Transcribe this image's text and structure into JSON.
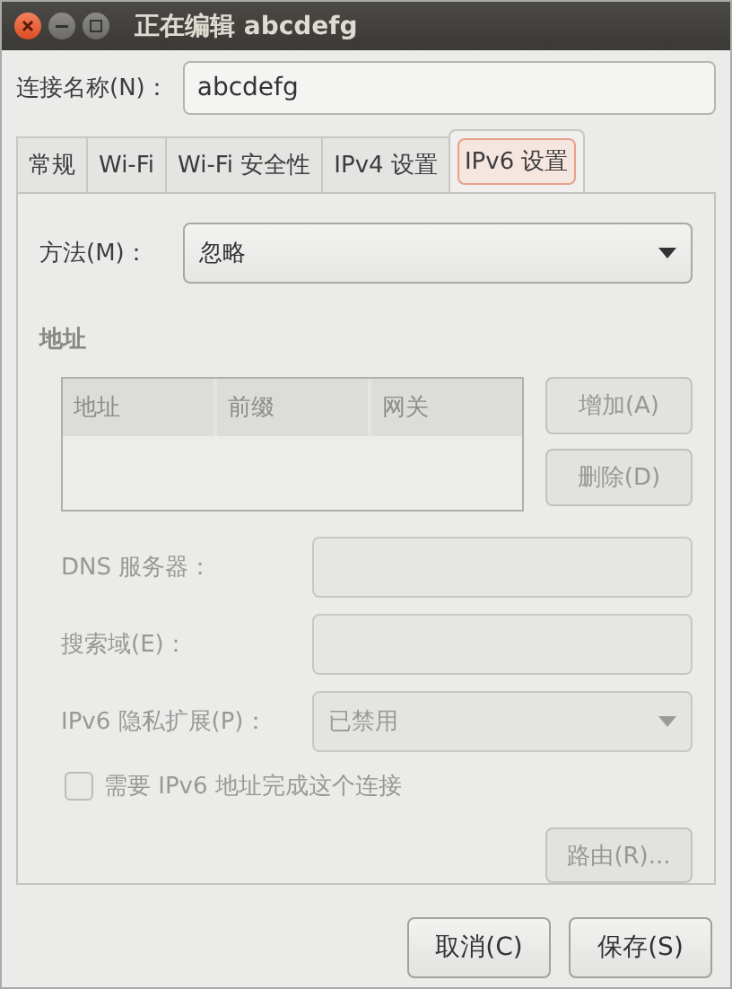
{
  "window": {
    "title": "正在编辑 abcdefg"
  },
  "connection_name": {
    "label": "连接名称(N)：",
    "value": "abcdefg"
  },
  "tabs": [
    {
      "label": "常规",
      "selected": false
    },
    {
      "label": "Wi-Fi",
      "selected": false
    },
    {
      "label": "Wi-Fi 安全性",
      "selected": false
    },
    {
      "label": "IPv4 设置",
      "selected": false
    },
    {
      "label": "IPv6 设置",
      "selected": true
    }
  ],
  "method": {
    "label": "方法(M)：",
    "value": "忽略"
  },
  "addresses": {
    "heading": "地址",
    "columns": [
      "地址",
      "前缀",
      "网关"
    ],
    "disabled": true,
    "buttons": [
      {
        "label": "增加(A)",
        "disabled": true
      },
      {
        "label": "删除(D)",
        "disabled": true
      }
    ]
  },
  "fields": [
    {
      "kind": "text",
      "label": "DNS 服务器：",
      "disabled": true
    },
    {
      "kind": "text",
      "label": "搜索域(E)：",
      "disabled": true
    },
    {
      "kind": "dropdown",
      "label": "IPv6 隐私扩展(P)：",
      "value": "已禁用",
      "disabled": true
    }
  ],
  "require_ipv6": {
    "label": "需要 IPv6 地址完成这个连接",
    "checked": false,
    "disabled": true
  },
  "routes_button": {
    "label": "路由(R)...",
    "disabled": true
  },
  "dialog_buttons": [
    "取消(C)",
    "保存(S)"
  ]
}
